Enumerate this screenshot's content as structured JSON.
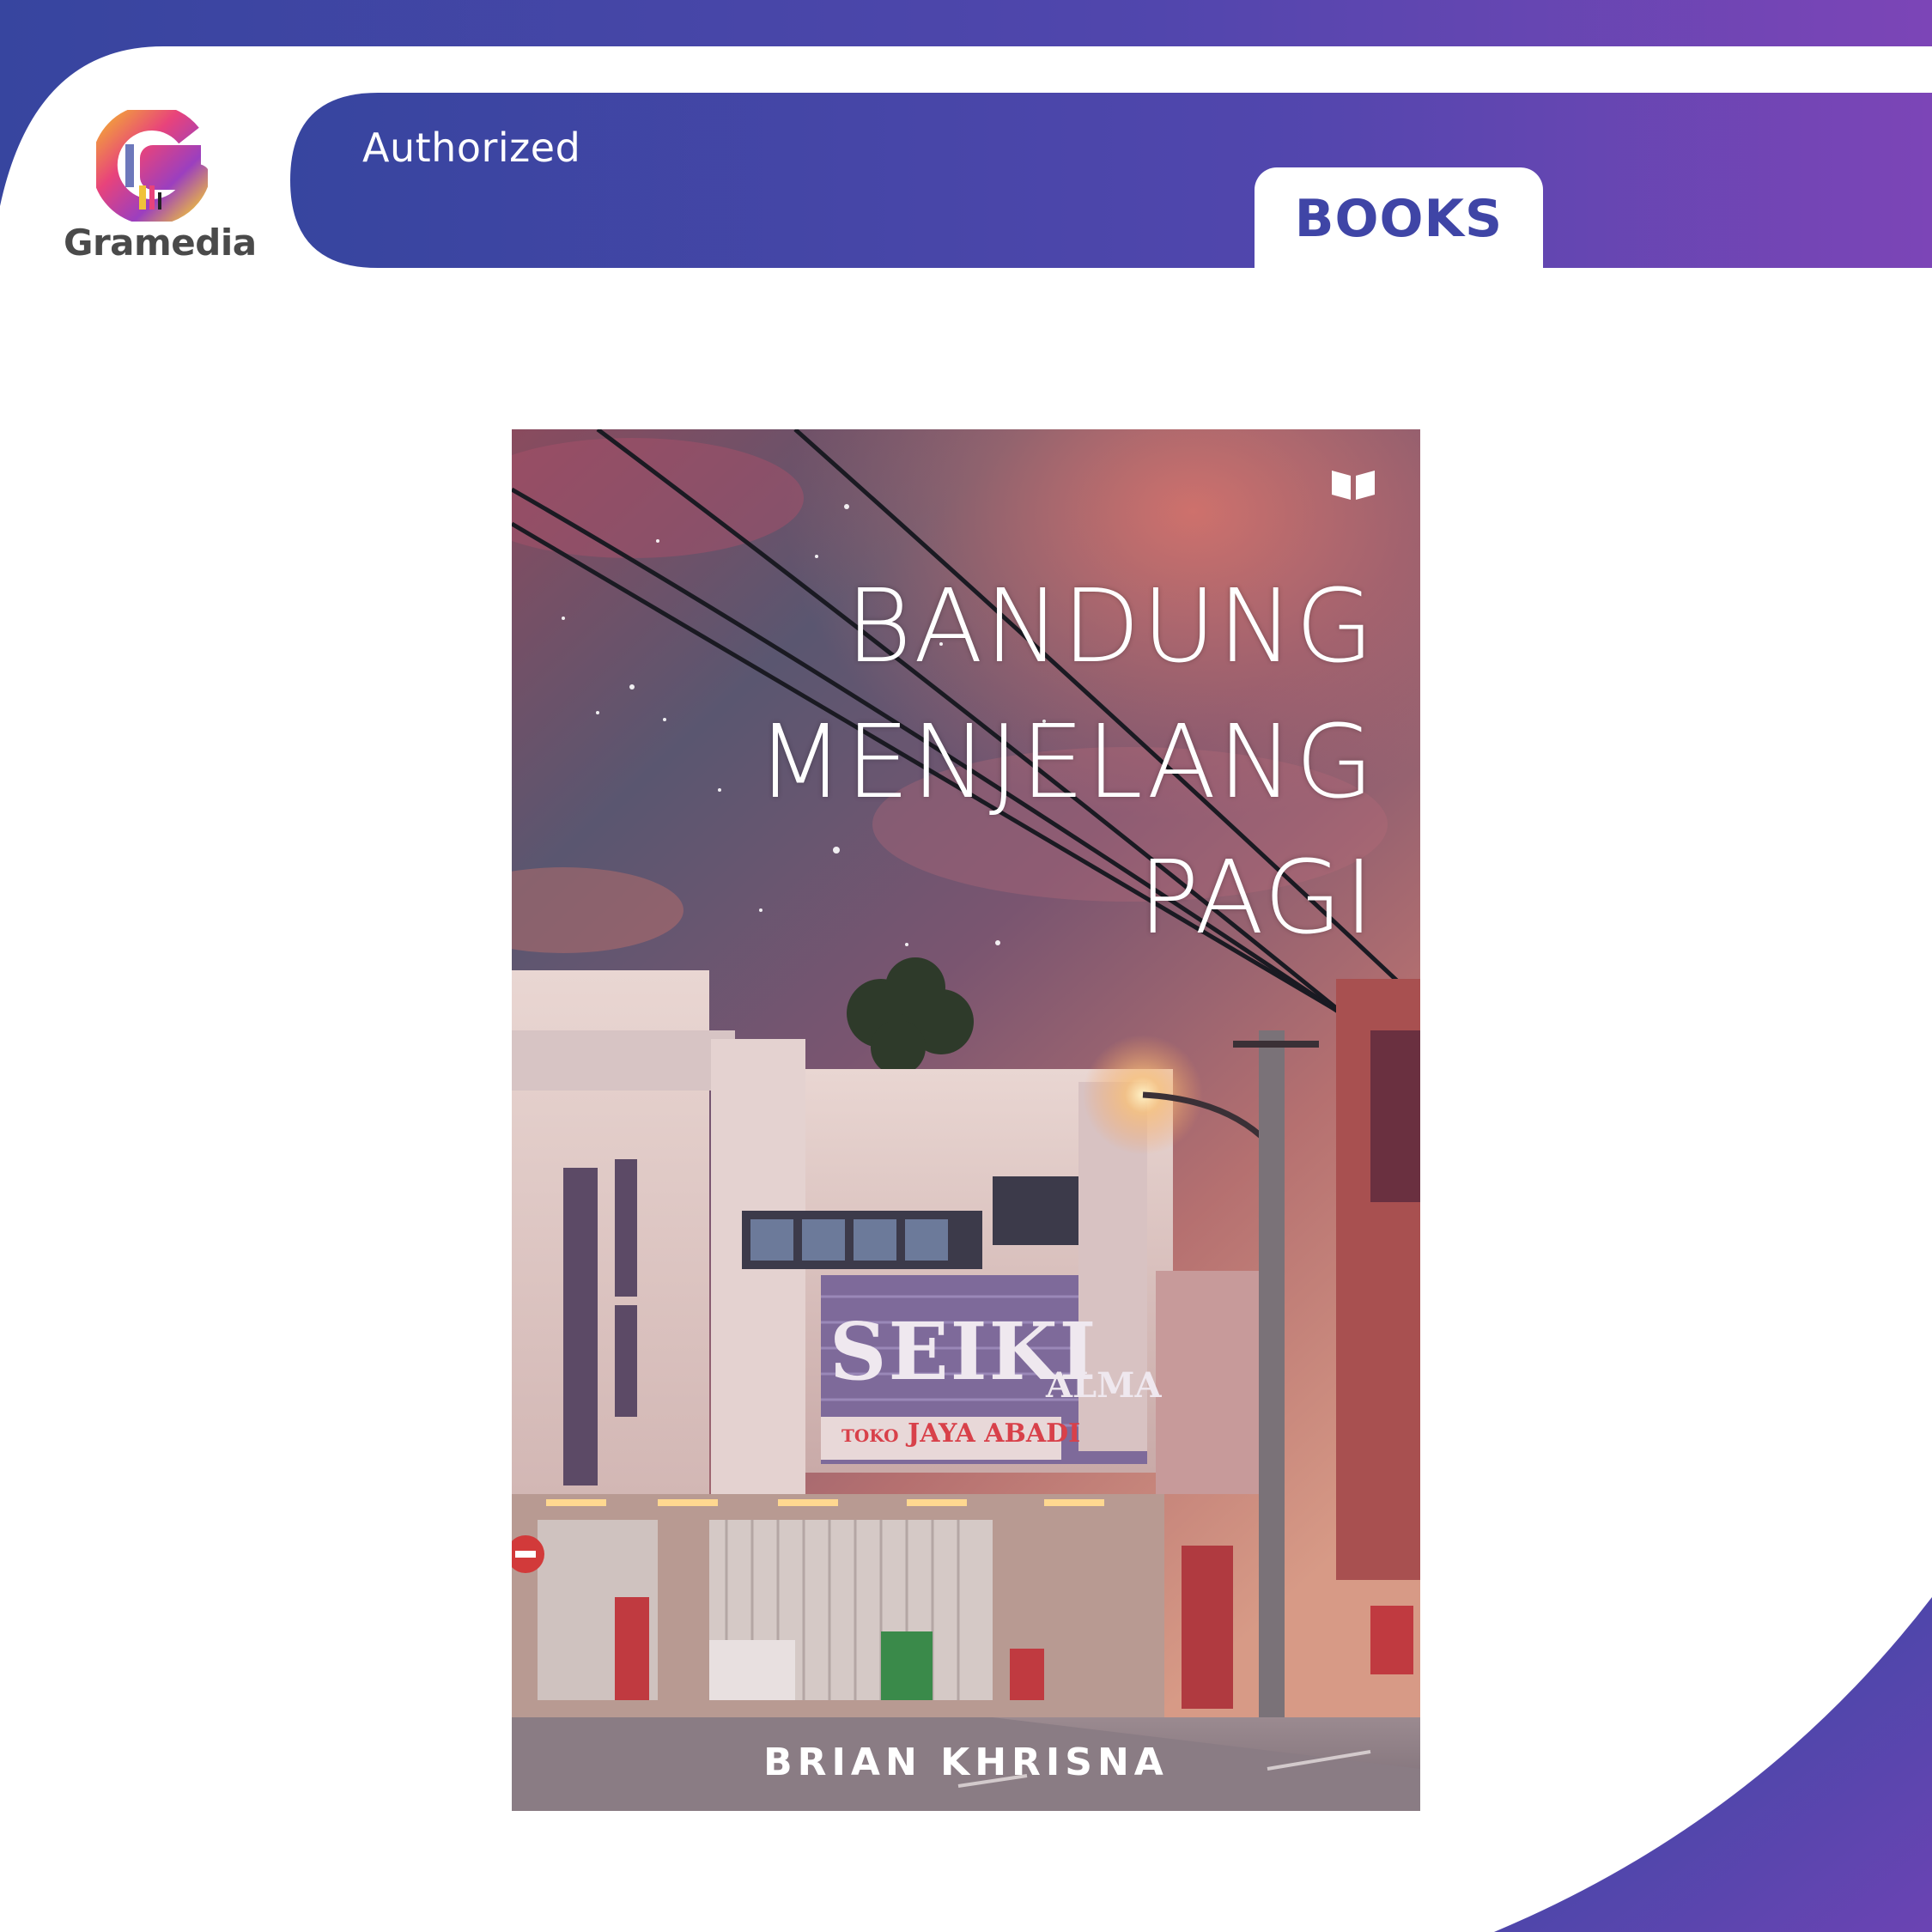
{
  "header": {
    "brand_name": "Gramedia",
    "badge_text": "Authorized",
    "category_tab": "BOOKS"
  },
  "cover": {
    "title_lines": [
      "BANDUNG",
      "MENJELANG",
      "PAGI"
    ],
    "author": "BRIAN KHRISNA",
    "sign_main": "SEIKI",
    "sign_side": "ALMA",
    "sign_toko_prefix": "TOKO",
    "sign_toko_name": "JAYA ABADI"
  },
  "colors": {
    "brand_gradient_start": "#3a4aa8",
    "brand_gradient_end": "#7a45b5",
    "tab_text": "#3f45a6"
  },
  "icons": [
    "gramedia-logo-icon",
    "publisher-book-icon"
  ]
}
